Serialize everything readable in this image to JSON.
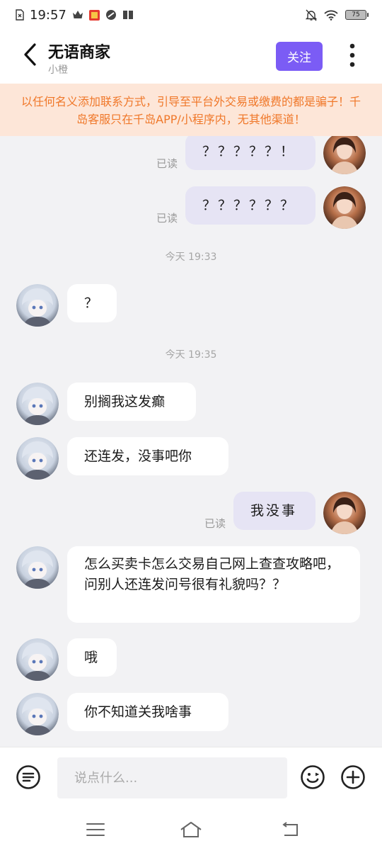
{
  "status_bar": {
    "time": "19:57",
    "battery": "75"
  },
  "header": {
    "title": "无语商家",
    "subtitle": "小橙",
    "follow_label": "关注"
  },
  "notice": "以任何名义添加联系方式，引导至平台外交易或缴费的都是骗子！千岛客服只在千岛APP/小程序内，无其他渠道！",
  "messages": [
    {
      "from": "me",
      "text": "？？？？？！",
      "status": "已读"
    },
    {
      "from": "me",
      "text": "？？？？？？",
      "status": "已读"
    },
    {
      "type": "time",
      "text": "今天 19:33"
    },
    {
      "from": "other",
      "text": "？"
    },
    {
      "type": "time",
      "text": "今天 19:35"
    },
    {
      "from": "other",
      "text": "别搁我这发癫"
    },
    {
      "from": "other",
      "text": "还连发，没事吧你"
    },
    {
      "from": "me",
      "text": "我没事",
      "status": "已读"
    },
    {
      "from": "other",
      "text": "怎么买卖卡怎么交易自己网上查查攻略吧，问别人还连发问号很有礼貌吗？？"
    },
    {
      "from": "other",
      "text": "哦"
    },
    {
      "from": "other",
      "text": "你不知道关我啥事"
    }
  ],
  "input": {
    "placeholder": "说点什么..."
  },
  "icons": {
    "back": "chevron-left-icon",
    "more": "more-vertical-icon",
    "menu": "menu-lines-icon",
    "emoji": "emoji-icon",
    "add": "plus-circle-icon"
  },
  "colors": {
    "accent": "#7b5cf5",
    "notice_text": "#f0782a",
    "notice_bg": "#fde6d8",
    "my_bubble": "#e6e4f4"
  }
}
